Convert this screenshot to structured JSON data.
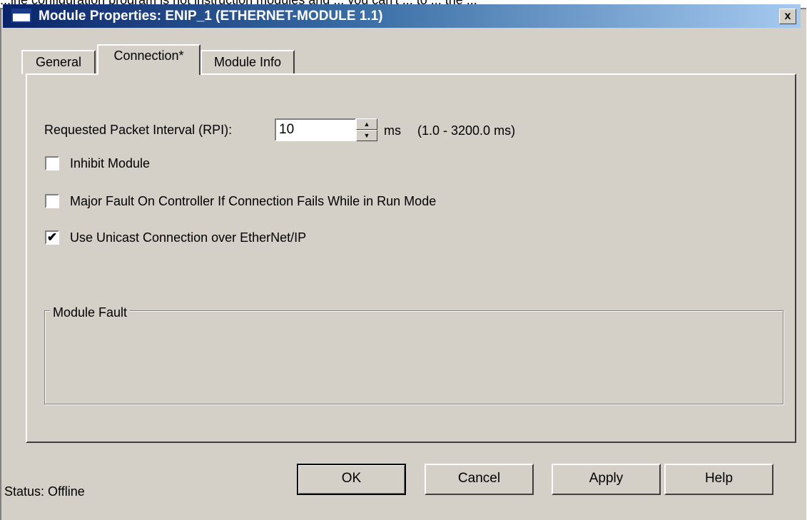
{
  "background_text": "...ine configuration program is not instruction modules and ... you can't ... to ... the ...",
  "window": {
    "title": "Module Properties: ENIP_1 (ETHERNET-MODULE 1.1)",
    "close_glyph": "x"
  },
  "tabs": [
    {
      "label": "General",
      "active": false
    },
    {
      "label": "Connection*",
      "active": true
    },
    {
      "label": "Module Info",
      "active": false
    }
  ],
  "connection": {
    "rpi_label": "Requested Packet Interval (RPI):",
    "rpi_value": "10",
    "rpi_unit": "ms",
    "rpi_range": "(1.0 - 3200.0 ms)",
    "inhibit_label": "Inhibit Module",
    "inhibit_checked": false,
    "major_fault_label": "Major Fault On Controller If Connection Fails While in Run Mode",
    "major_fault_checked": false,
    "unicast_label": "Use Unicast Connection over EtherNet/IP",
    "unicast_checked": true,
    "unicast_mark": "✔",
    "module_fault_legend": "Module Fault"
  },
  "footer": {
    "status": "Status:  Offline",
    "ok_label": "OK",
    "cancel_label": "Cancel",
    "apply_label": "Apply",
    "help_label": "Help"
  }
}
